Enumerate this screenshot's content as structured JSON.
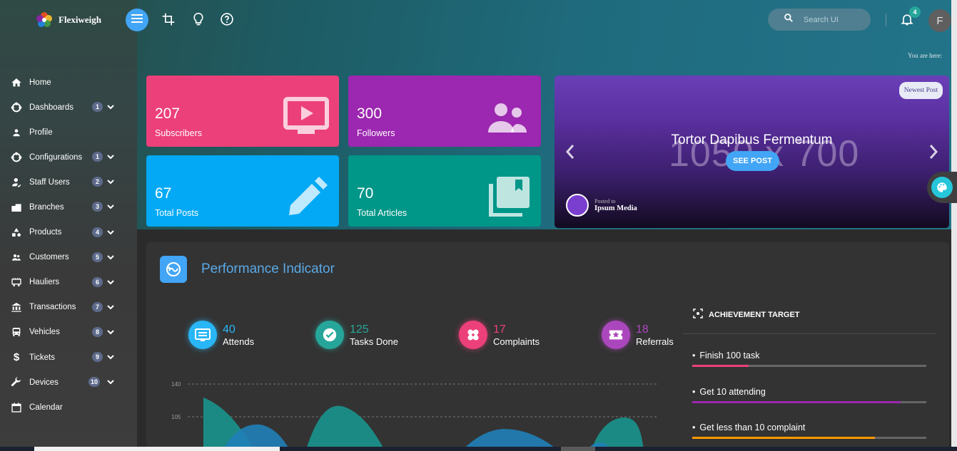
{
  "app": {
    "name": "Flexiweigh"
  },
  "topbar": {
    "search_placeholder": "Search UI",
    "notifications_count": "4",
    "avatar_initial": "F",
    "breadcrumb": "You are here:"
  },
  "sidebar": {
    "items": [
      {
        "label": "Home",
        "icon": "home-icon",
        "badge": ""
      },
      {
        "label": "Dashboards",
        "icon": "dashboard-icon",
        "badge": "1"
      },
      {
        "label": "Profile",
        "icon": "person-icon",
        "badge": ""
      },
      {
        "label": "Configurations",
        "icon": "settings-icon",
        "badge": "1"
      },
      {
        "label": "Staff Users",
        "icon": "staff-icon",
        "badge": "2"
      },
      {
        "label": "Branches",
        "icon": "building-icon",
        "badge": "3"
      },
      {
        "label": "Products",
        "icon": "shapes-icon",
        "badge": "4"
      },
      {
        "label": "Customers",
        "icon": "people-icon",
        "badge": "5"
      },
      {
        "label": "Hauliers",
        "icon": "truck-icon",
        "badge": "6"
      },
      {
        "label": "Transactions",
        "icon": "bank-icon",
        "badge": "7"
      },
      {
        "label": "Vehicles",
        "icon": "bus-icon",
        "badge": "8"
      },
      {
        "label": "Tickets",
        "icon": "dollar-icon",
        "badge": "9"
      },
      {
        "label": "Devices",
        "icon": "wrench-icon",
        "badge": "10"
      },
      {
        "label": "Calendar",
        "icon": "calendar-icon",
        "badge": ""
      }
    ]
  },
  "stats": [
    {
      "value": "207",
      "label": "Subscribers",
      "color": "#ec407a",
      "icon": "monitor-play-icon"
    },
    {
      "value": "300",
      "label": "Followers",
      "color": "#9c27b0",
      "icon": "group-icon"
    },
    {
      "value": "67",
      "label": "Total Posts",
      "color": "#03a9f4",
      "icon": "pencil-icon"
    },
    {
      "value": "70",
      "label": "Total Articles",
      "color": "#009688",
      "icon": "library-icon"
    }
  ],
  "carousel": {
    "badge": "Newest Post",
    "placeholder_text": "1050 x 700",
    "title": "Tortor Dapibus Fermentum",
    "button": "SEE POST",
    "posted_to": "Posted to",
    "author": "Ipsum Media"
  },
  "performance": {
    "title": "Performance Indicator",
    "metrics": [
      {
        "value": "40",
        "label": "Attends",
        "color": "#29b6f6",
        "icon": "id-card-icon"
      },
      {
        "value": "125",
        "label": "Tasks Done",
        "color": "#26a69a",
        "icon": "check-circle-icon"
      },
      {
        "value": "17",
        "label": "Complaints",
        "color": "#ec407a",
        "icon": "bandage-icon"
      },
      {
        "value": "18",
        "label": "Referrals",
        "color": "#ab47bc",
        "icon": "star-ticket-icon"
      }
    ],
    "chart_axis": [
      "140",
      "105"
    ],
    "achievement": {
      "title": "ACHIEVEMENT TARGET",
      "goals": [
        {
          "label": "Finish 100 task",
          "progress": 0.24,
          "color": "#ec407a"
        },
        {
          "label": "Get 10 attending",
          "progress": 0.89,
          "color": "#9c27b0"
        },
        {
          "label": "Get less than 10 complaint",
          "progress": 0.78,
          "color": "#ff9800"
        }
      ]
    }
  }
}
